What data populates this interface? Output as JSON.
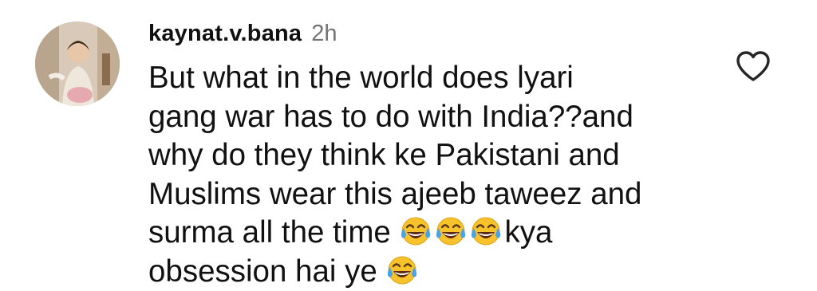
{
  "comment": {
    "username": "kaynat.v.bana",
    "timestamp": "2h",
    "lines": [
      "But what in the world does lyari",
      "gang war has to do with India??and",
      "why do they think ke Pakistani and",
      "Muslims wear this ajeeb taweez and"
    ],
    "line5_text": "surma all the time",
    "line5_suffix": "kya",
    "line6_text": "obsession hai ye",
    "emoji_name": "face-with-tears-of-joy",
    "like_icon": "heart-outline-icon"
  },
  "colors": {
    "text": "#111111",
    "timestamp": "#737373",
    "background": "#ffffff",
    "emoji_face": "#f7c22b",
    "emoji_tears": "#4aa3e8"
  }
}
